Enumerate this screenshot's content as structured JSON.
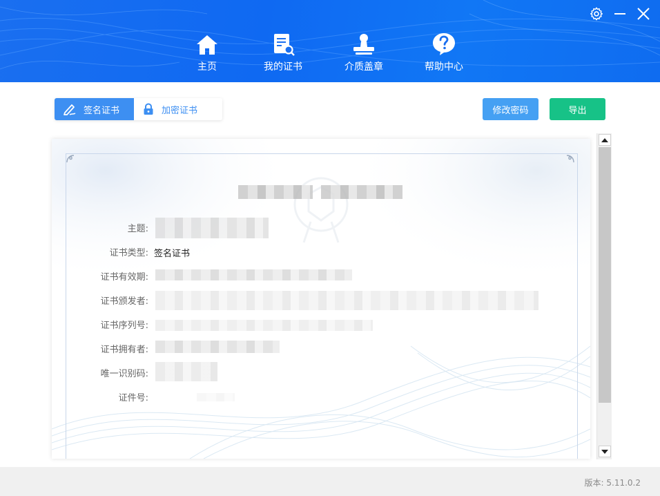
{
  "nav": {
    "items": [
      {
        "label": "主页",
        "icon": "home-icon"
      },
      {
        "label": "我的证书",
        "icon": "certificate-search-icon"
      },
      {
        "label": "介质盖章",
        "icon": "stamp-icon"
      },
      {
        "label": "帮助中心",
        "icon": "help-icon"
      }
    ]
  },
  "window_controls": {
    "settings_icon": "gear-icon",
    "minimize_icon": "minimize-icon",
    "close_icon": "close-icon"
  },
  "tabs": {
    "sign": {
      "label": "签名证书",
      "icon": "pen-icon"
    },
    "encrypt": {
      "label": "加密证书",
      "icon": "lock-icon"
    }
  },
  "buttons": {
    "change_password": "修改密码",
    "export": "导出"
  },
  "certificate": {
    "fields": [
      {
        "label": "主题:",
        "value": ""
      },
      {
        "label": "证书类型:",
        "value": "签名证书"
      },
      {
        "label": "证书有效期:",
        "value": ""
      },
      {
        "label": "证书颁发者:",
        "value": ""
      },
      {
        "label": "证书序列号:",
        "value": ""
      },
      {
        "label": "证书拥有者:",
        "value": ""
      },
      {
        "label": "唯一识别码:",
        "value": ""
      },
      {
        "label": "证件号:",
        "value": ""
      }
    ]
  },
  "footer": {
    "version": "版本: 5.11.0.2"
  },
  "colors": {
    "header_blue": "#1a6ff0",
    "tab_active": "#3d8ff2",
    "btn_blue": "#45a0f3",
    "btn_green": "#17c287"
  }
}
